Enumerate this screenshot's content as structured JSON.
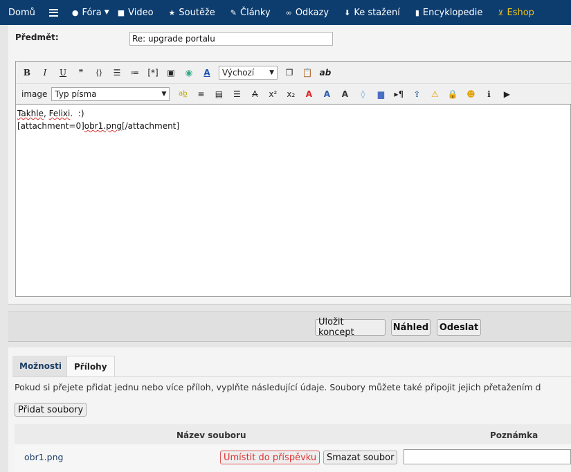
{
  "nav": {
    "home": "Domů",
    "forums": "Fóra",
    "video": "Video",
    "contests": "Soutěže",
    "articles": "Články",
    "links": "Odkazy",
    "downloads": "Ke stažení",
    "encyclopedia": "Encyklopedie",
    "eshop": "Eshop"
  },
  "subject": {
    "label": "Předmět:",
    "value": "Re: upgrade portalu"
  },
  "toolbar": {
    "size_select": "Výchozí",
    "image_label": "image",
    "font_select": "Typ písma"
  },
  "editor": {
    "line1": {
      "a": "Takhle",
      "b": ", ",
      "c": "Felixi",
      "d": ".  :)"
    },
    "line2": {
      "a": "[attachment=0]",
      "b": "obr1.png",
      "c": "[/attachment]"
    }
  },
  "actions": {
    "save_draft": "Uložit koncept",
    "preview": "Náhled",
    "submit": "Odeslat"
  },
  "tabs": {
    "options": "Možnosti",
    "attachments": "Přílohy"
  },
  "attachments": {
    "info": "Pokud si přejete přidat jednu nebo více příloh, vyplňte následující údaje. Soubory můžete také připojit jejich přetažením d",
    "add_button": "Přidat soubory",
    "col_filename": "Název souboru",
    "col_note": "Poznámka",
    "file": {
      "name": "obr1.png",
      "place_button": "Umístit do příspěvku",
      "delete_button": "Smazat soubor"
    }
  },
  "colors": {
    "nav_bg": "#0d3c6e",
    "eshop": "#f0c419",
    "link": "#1d3e66",
    "danger": "#dd3333"
  }
}
